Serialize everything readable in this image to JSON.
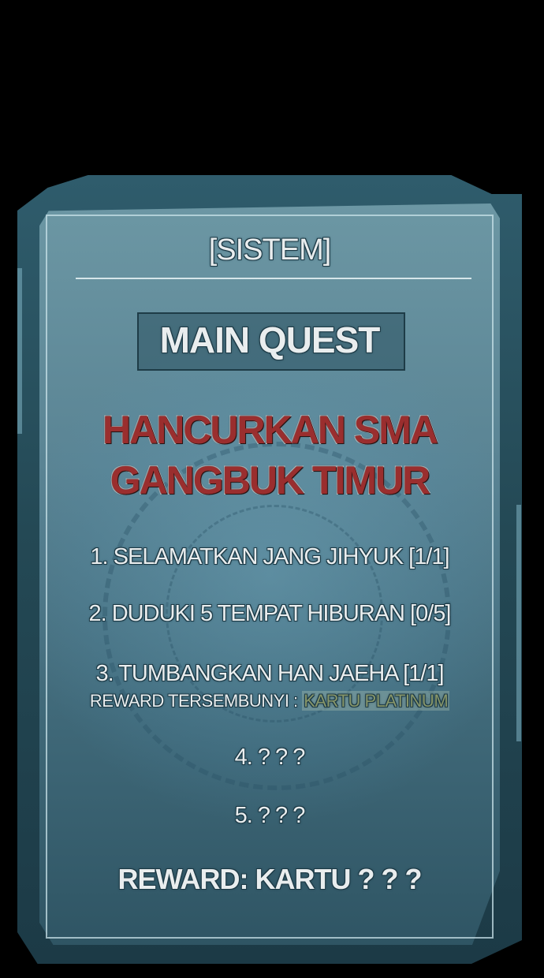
{
  "system": {
    "title": "[SISTEM]"
  },
  "quest": {
    "type_label": "MAIN QUEST",
    "name_line1": "HANCURKAN SMA",
    "name_line2": "GANGBUK TIMUR"
  },
  "tasks": [
    {
      "text": "1. SELAMATKAN JANG JIHYUK  [1/1]"
    },
    {
      "text": "2. DUDUKI 5 TEMPAT HIBURAN  [0/5]"
    },
    {
      "text": "3. TUMBANGKAN HAN JAEHA  [1/1]"
    },
    {
      "text": "4. ? ? ?"
    },
    {
      "text": "5. ? ? ?"
    }
  ],
  "hidden_reward": {
    "label": "REWARD TERSEMBUNYI : ",
    "value": "KARTU PLATINUM"
  },
  "reward": {
    "text": "REWARD: KARTU ? ? ?"
  },
  "colors": {
    "panel": "#5a8494",
    "frame": "#244955",
    "quest_name": "#9a2e2e",
    "text": "#e9edee",
    "hidden_value": "#87966a"
  }
}
